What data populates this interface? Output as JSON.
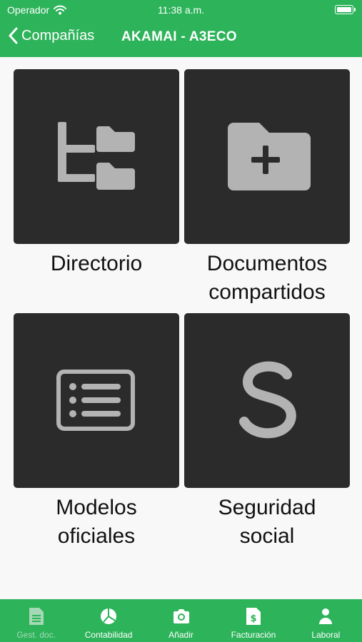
{
  "status_bar": {
    "carrier": "Operador",
    "time": "11:38 a.m."
  },
  "nav": {
    "back_label": "Compañías",
    "title": "AKAMAI - A3ECO"
  },
  "tiles": [
    {
      "label_line1": "Directorio",
      "label_line2": "",
      "icon": "folder-tree-icon"
    },
    {
      "label_line1": "Documentos",
      "label_line2": "compartidos",
      "icon": "folder-add-icon"
    },
    {
      "label_line1": "Modelos",
      "label_line2": "oficiales",
      "icon": "list-card-icon"
    },
    {
      "label_line1": "Seguridad",
      "label_line2": "social",
      "icon": "letter-s-icon"
    }
  ],
  "tabs": [
    {
      "label": "Gest. doc.",
      "icon": "document-icon",
      "active": true
    },
    {
      "label": "Contabilidad",
      "icon": "pie-chart-icon",
      "active": false
    },
    {
      "label": "Añadir",
      "icon": "camera-icon",
      "active": false
    },
    {
      "label": "Facturación",
      "icon": "invoice-icon",
      "active": false
    },
    {
      "label": "Laboral",
      "icon": "person-icon",
      "active": false
    }
  ],
  "colors": {
    "brand_green": "#2db35a",
    "tile_bg": "#2b2b2b",
    "icon_gray": "#b3b3b3",
    "active_tab": "#a5d9b5"
  }
}
